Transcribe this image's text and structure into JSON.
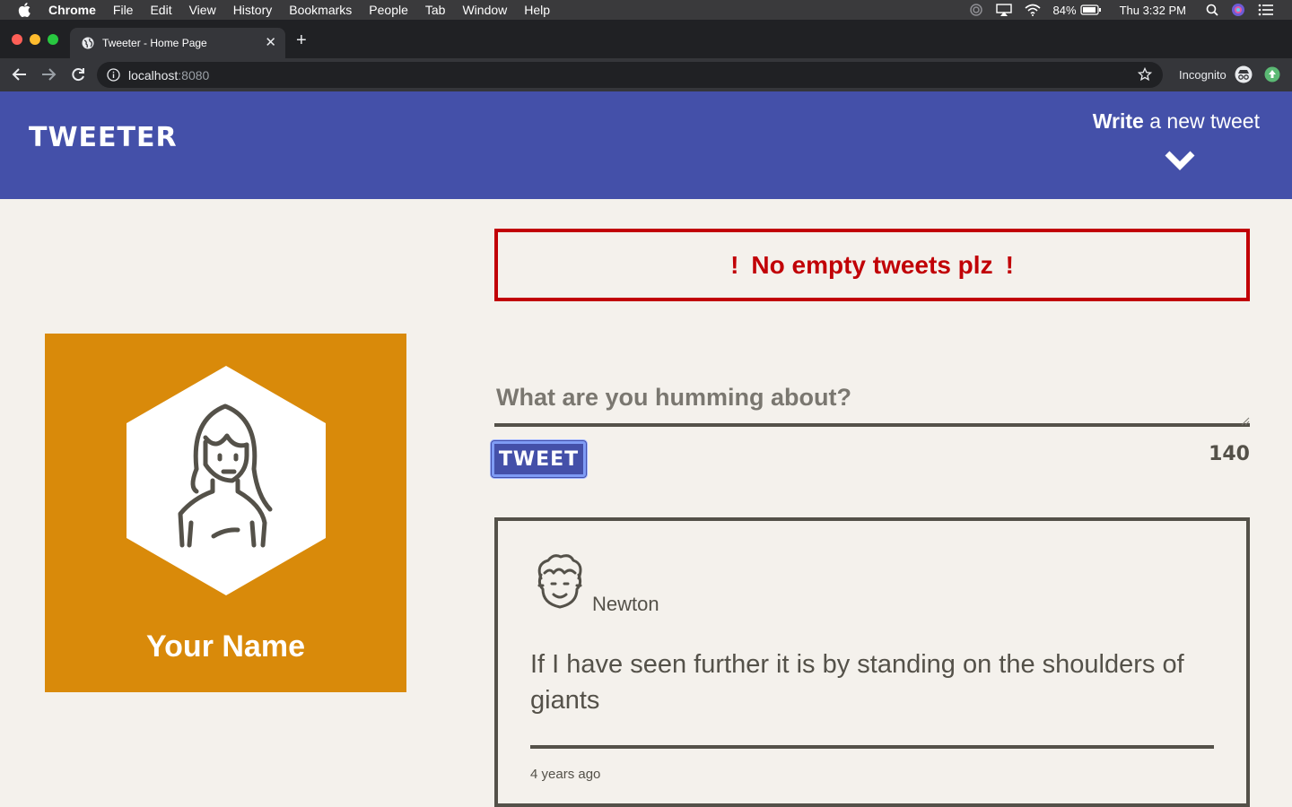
{
  "menubar": {
    "app_name": "Chrome",
    "items": [
      "File",
      "Edit",
      "View",
      "History",
      "Bookmarks",
      "People",
      "Tab",
      "Window",
      "Help"
    ],
    "battery": "84%",
    "clock": "Thu 3:32 PM"
  },
  "browser": {
    "tab_title": "Tweeter - Home Page",
    "url_host": "localhost",
    "url_port": ":8080",
    "profile_label": "Incognito"
  },
  "nav": {
    "logo": "TWEETER",
    "compose_bold": "Write",
    "compose_rest": " a new tweet",
    "accent": "#4450a9"
  },
  "profile": {
    "name": "Your Name",
    "card_color": "#d98a0a"
  },
  "error": {
    "bang_left": "!",
    "message": "No empty tweets plz",
    "bang_right": "!",
    "color": "#c10006"
  },
  "compose": {
    "placeholder": "What are you humming about?",
    "submit_label": "TWEET",
    "counter": "140"
  },
  "tweets": [
    {
      "author": "Newton",
      "content": "If I have seen further it is by standing on the shoulders of giants",
      "time": "4 years ago"
    }
  ]
}
